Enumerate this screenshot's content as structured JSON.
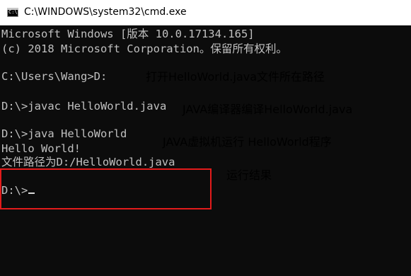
{
  "window": {
    "icon_label": "C:\\",
    "title": "C:\\WINDOWS\\system32\\cmd.exe"
  },
  "console": {
    "lines": [
      "Microsoft Windows [版本 10.0.17134.165]",
      "(c) 2018 Microsoft Corporation。保留所有权利。",
      "",
      "C:\\Users\\Wang>D:",
      "",
      "D:\\>javac HelloWorld.java",
      "",
      "D:\\>java HelloWorld",
      "Hello World!",
      "文件路径为D:/HelloWorld.java",
      "",
      "D:\\>"
    ]
  },
  "annotations": {
    "open_file": "打开HelloWorld.java文件所在路径",
    "compile": "JAVA编译器编译HelloWorld.java",
    "run": "JAVA虚拟机运行 HelloWorld程序",
    "result": "运行结果"
  },
  "colors": {
    "console_text": "#c0c0c0",
    "highlight_border": "#e31b1b",
    "annotation_text": "#000000"
  }
}
